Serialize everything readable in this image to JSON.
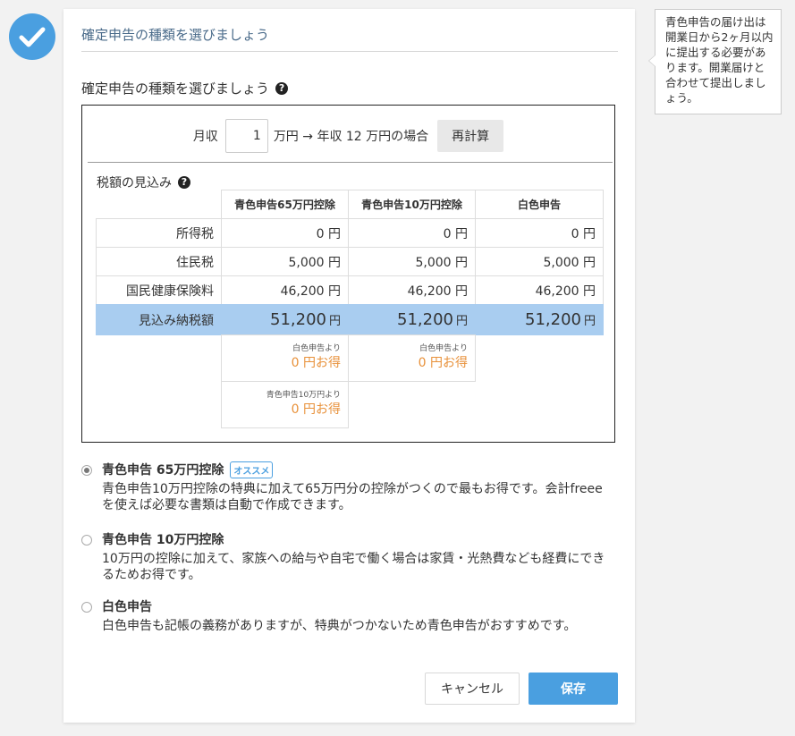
{
  "card": {
    "title": "確定申告の種類を選びましょう",
    "section_heading": "確定申告の種類を選びましょう"
  },
  "calculator": {
    "monthly_label": "月収",
    "monthly_value": "1",
    "suffix_text": "万円 → 年収 12 万円の場合",
    "recalc_label": "再計算"
  },
  "estimate": {
    "label": "税額の見込み",
    "columns": [
      "青色申告65万円控除",
      "青色申告10万円控除",
      "白色申告"
    ],
    "rows": [
      {
        "label": "所得税",
        "values": [
          "0 円",
          "0 円",
          "0 円"
        ]
      },
      {
        "label": "住民税",
        "values": [
          "5,000 円",
          "5,000 円",
          "5,000 円"
        ]
      },
      {
        "label": "国民健康保険料",
        "values": [
          "46,200 円",
          "46,200 円",
          "46,200 円"
        ]
      }
    ],
    "total": {
      "label": "見込み納税額",
      "values": [
        "51,200",
        "51,200",
        "51,200"
      ],
      "unit": "円"
    },
    "savings": [
      {
        "caption": "白色申告より",
        "amount": "0 円お得"
      },
      {
        "caption": "白色申告より",
        "amount": "0 円お得"
      },
      {
        "caption": "青色申告10万円より",
        "amount": "0 円お得"
      }
    ]
  },
  "options": [
    {
      "title": "青色申告 65万円控除",
      "badge": "オススメ",
      "selected": true,
      "description": "青色申告10万円控除の特典に加えて65万円分の控除がつくので最もお得です。会計freeeを使えば必要な書類は自動で作成できます。"
    },
    {
      "title": "青色申告 10万円控除",
      "selected": false,
      "description": "10万円の控除に加えて、家族への給与や自宅で働く場合は家賃・光熱費なども経費にできるためお得です。"
    },
    {
      "title": "白色申告",
      "selected": false,
      "description": "白色申告も記帳の義務がありますが、特典がつかないため青色申告がおすすめです。"
    }
  ],
  "buttons": {
    "cancel": "キャンセル",
    "save": "保存"
  },
  "tooltip": {
    "text": "青色申告の届け出は開業日から2ヶ月以内に提出する必要があります。開業届けと合わせて提出しましょう。"
  },
  "icons": {
    "status": "check-circle-icon",
    "help": "question-circle-icon"
  },
  "colors": {
    "accent": "#4a9fe0",
    "total_row": "#a9cdf0",
    "savings": "#e8913a"
  }
}
